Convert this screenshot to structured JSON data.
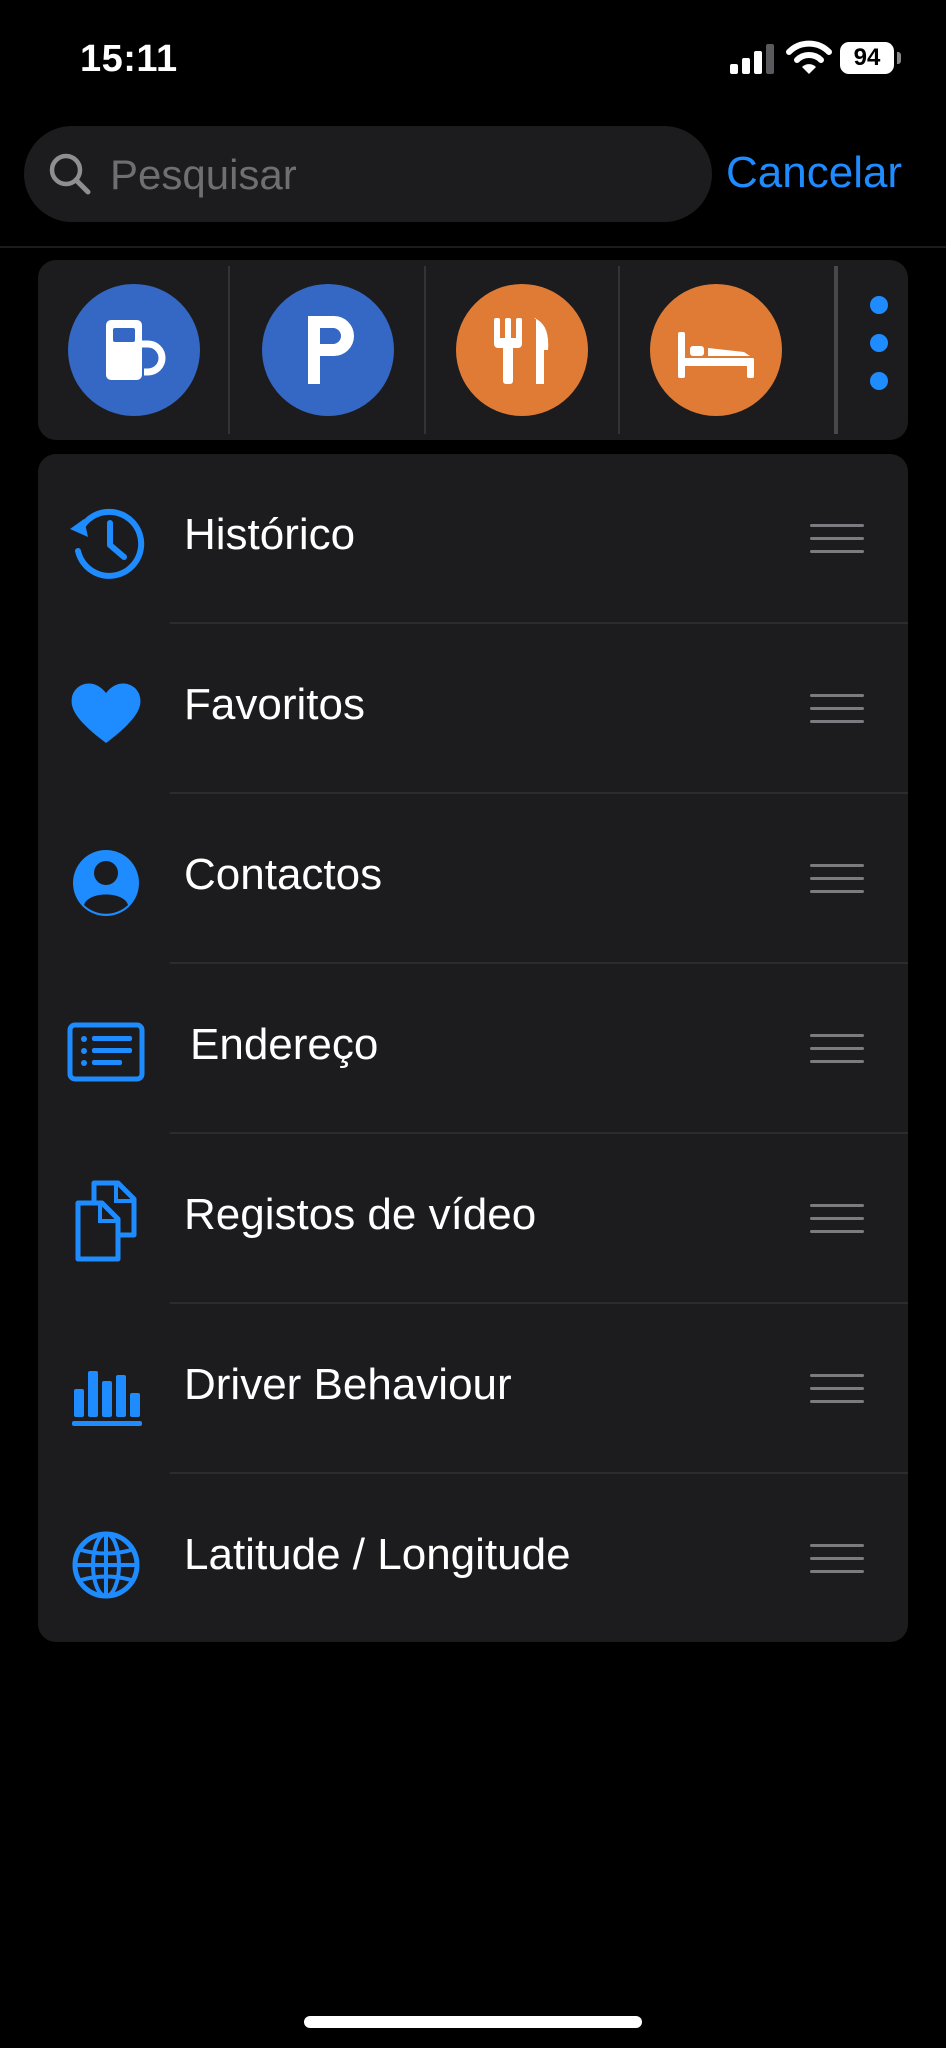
{
  "status": {
    "time": "15:11",
    "battery": "94"
  },
  "search": {
    "placeholder": "Pesquisar",
    "value": "",
    "cancel_label": "Cancelar"
  },
  "categories": [
    {
      "icon": "fuel-pump-icon",
      "color": "#3468c4"
    },
    {
      "icon": "parking-icon",
      "color": "#3468c4"
    },
    {
      "icon": "restaurant-icon",
      "color": "#e07b35"
    },
    {
      "icon": "hotel-bed-icon",
      "color": "#e07b35"
    }
  ],
  "list": {
    "items": [
      {
        "label": "Histórico",
        "icon": "history-clock-icon"
      },
      {
        "label": "Favoritos",
        "icon": "heart-icon"
      },
      {
        "label": "Contactos",
        "icon": "contact-person-icon"
      },
      {
        "label": "Endereço",
        "icon": "address-list-icon"
      },
      {
        "label": "Registos de vídeo",
        "icon": "documents-icon"
      },
      {
        "label": "Driver Behaviour",
        "icon": "bar-chart-icon"
      },
      {
        "label": "Latitude / Longitude",
        "icon": "globe-icon"
      }
    ]
  },
  "colors": {
    "accent": "#1e8bff",
    "panel": "#1c1c1e",
    "background": "#000000"
  }
}
